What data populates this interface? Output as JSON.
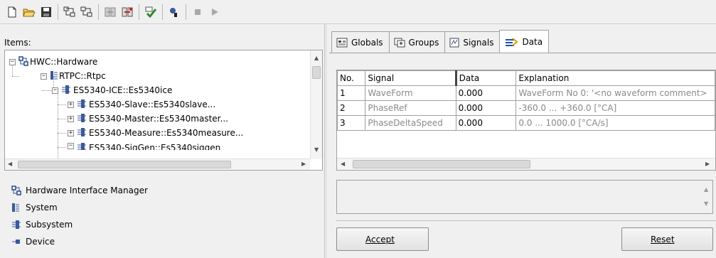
{
  "toolbar": {
    "buttons": [
      "new-icon",
      "open-icon",
      "save-icon",
      "tree-expand-icon",
      "tree-collapse-icon",
      "import-icon",
      "export-icon",
      "check-icon",
      "search-icon",
      "stop-icon",
      "run-icon"
    ]
  },
  "items": {
    "label": "Items:",
    "tree": [
      {
        "label": "HWC::Hardware",
        "icon": "hardware-icon",
        "expanded": true
      },
      {
        "label": "RTPC::Rtpc",
        "icon": "system-icon",
        "expanded": true
      },
      {
        "label": "ES5340-ICE::Es5340ice",
        "icon": "subsystem-icon",
        "expanded": true
      },
      {
        "label": "ES5340-Slave::Es5340slave...",
        "icon": "subsystem-icon",
        "expanded": false
      },
      {
        "label": "ES5340-Master::Es5340master...",
        "icon": "subsystem-icon",
        "expanded": false
      },
      {
        "label": "ES5340-Measure::Es5340measure...",
        "icon": "subsystem-icon",
        "expanded": false
      },
      {
        "label": "ES5340-SigGen::Es5340siggen",
        "icon": "subsystem-icon",
        "expanded": true
      }
    ]
  },
  "legend": [
    {
      "label": "Hardware Interface Manager",
      "icon": "hardware-icon"
    },
    {
      "label": "System",
      "icon": "system-icon"
    },
    {
      "label": "Subsystem",
      "icon": "subsystem-icon"
    },
    {
      "label": "Device",
      "icon": "device-icon"
    }
  ],
  "tabs": [
    {
      "label": "Globals",
      "icon": "globals-icon"
    },
    {
      "label": "Groups",
      "icon": "groups-icon"
    },
    {
      "label": "Signals",
      "icon": "signals-icon"
    },
    {
      "label": "Data",
      "icon": "data-icon",
      "active": true
    }
  ],
  "grid": {
    "columns": [
      "No.",
      "Signal",
      "Data",
      "Explanation"
    ],
    "rows": [
      {
        "no": "1",
        "signal": "WaveForm",
        "data": "0.000",
        "explanation": "WaveForm No 0: '<no waveform comment>"
      },
      {
        "no": "2",
        "signal": "PhaseRef",
        "data": "0.000",
        "explanation": "-360.0 ... +360.0 [°CA]"
      },
      {
        "no": "3",
        "signal": "PhaseDeltaSpeed",
        "data": "0.000",
        "explanation": "0.0 ... 1000.0 [°CA/s]"
      }
    ]
  },
  "buttons": {
    "accept": "Accept",
    "reset": "Reset"
  },
  "colors": {
    "subsystem": "#3a5a9a",
    "hardware": "#2a4a8a",
    "check": "#2e8b2e",
    "run_disabled": "#a8a8a8"
  }
}
